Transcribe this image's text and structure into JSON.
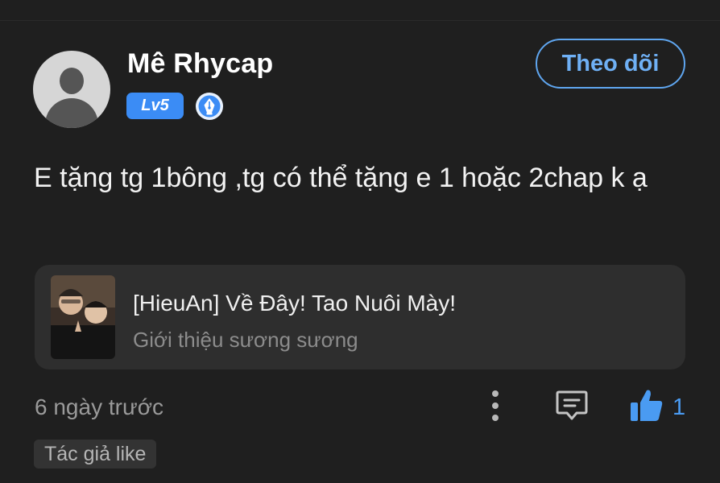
{
  "user": {
    "name": "Mê Rhycap",
    "level": "Lv5"
  },
  "follow_label": "Theo dõi",
  "comment": {
    "text": "E tặng tg 1bông ,tg có thể tặng e 1 hoặc 2chap k ạ"
  },
  "story": {
    "title": "[HieuAn] Về Đây! Tao Nuôi Mày!",
    "subtitle": "Giới thiệu sương sương"
  },
  "meta": {
    "time": "6 ngày trước",
    "like_count": "1"
  },
  "tag": "Tác giả like",
  "colors": {
    "background": "#1f1f1f",
    "accent": "#3b8cf5",
    "like": "#4a9bf2"
  },
  "icons": [
    "avatar-placeholder-icon",
    "pen-badge-icon",
    "more-vertical-icon",
    "comment-reply-icon",
    "thumbs-up-icon"
  ]
}
